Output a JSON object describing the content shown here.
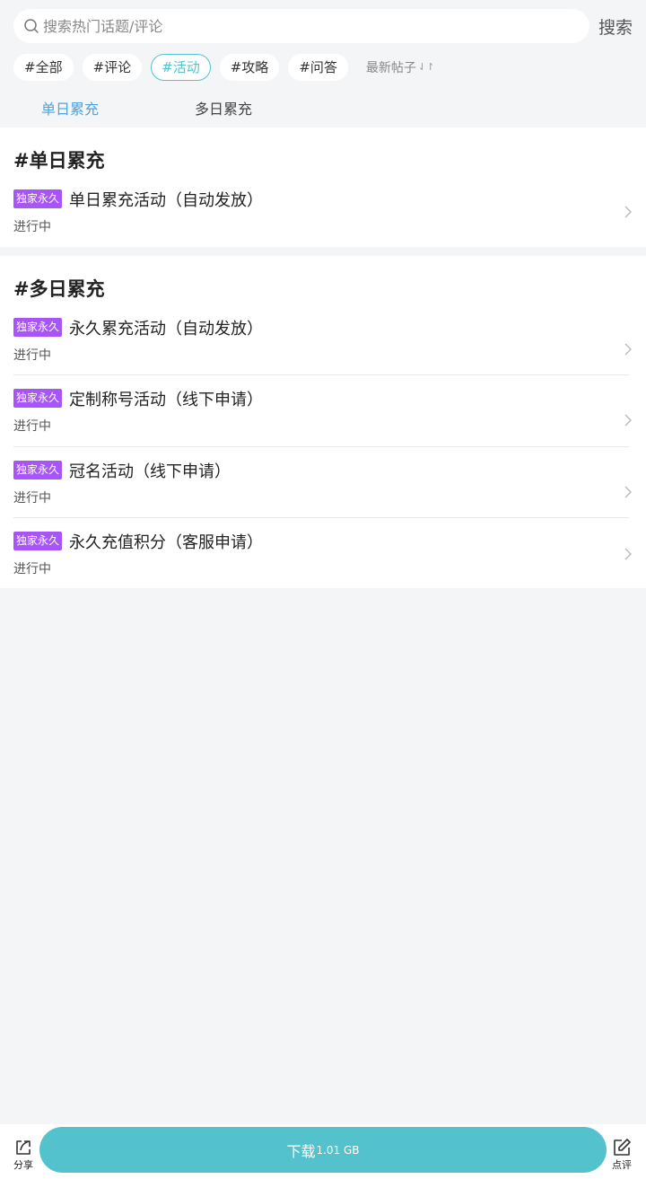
{
  "search": {
    "placeholder": "搜索热门话题/评论",
    "button_label": "搜索"
  },
  "tags": [
    {
      "label": "#全部",
      "active": false
    },
    {
      "label": "#评论",
      "active": false
    },
    {
      "label": "#活动",
      "active": true
    },
    {
      "label": "#攻略",
      "active": false
    },
    {
      "label": "#问答",
      "active": false
    }
  ],
  "sort": {
    "label": "最新帖子",
    "icon": "sort-arrows-icon"
  },
  "subtabs": [
    {
      "label": "单日累充",
      "active": true
    },
    {
      "label": "多日累充",
      "active": false
    }
  ],
  "sections": [
    {
      "title": "#单日累充",
      "items": [
        {
          "badge": "独家永久",
          "name": "单日累充活动（自动发放）",
          "status": "进行中"
        }
      ]
    },
    {
      "title": "#多日累充",
      "items": [
        {
          "badge": "独家永久",
          "name": "永久累充活动（自动发放）",
          "status": "进行中"
        },
        {
          "badge": "独家永久",
          "name": "定制称号活动（线下申请）",
          "status": "进行中"
        },
        {
          "badge": "独家永久",
          "name": "冠名活动（线下申请）",
          "status": "进行中"
        },
        {
          "badge": "独家永久",
          "name": "永久充值积分（客服申请）",
          "status": "进行中"
        }
      ]
    }
  ],
  "bottom": {
    "share_label": "分享",
    "download_label": "下载",
    "download_size": "1.01 GB",
    "review_label": "点评"
  },
  "colors": {
    "accent": "#53c2cc",
    "badge": "#a855f7",
    "active_tab": "#4da3df",
    "background": "#f4f5f7"
  }
}
